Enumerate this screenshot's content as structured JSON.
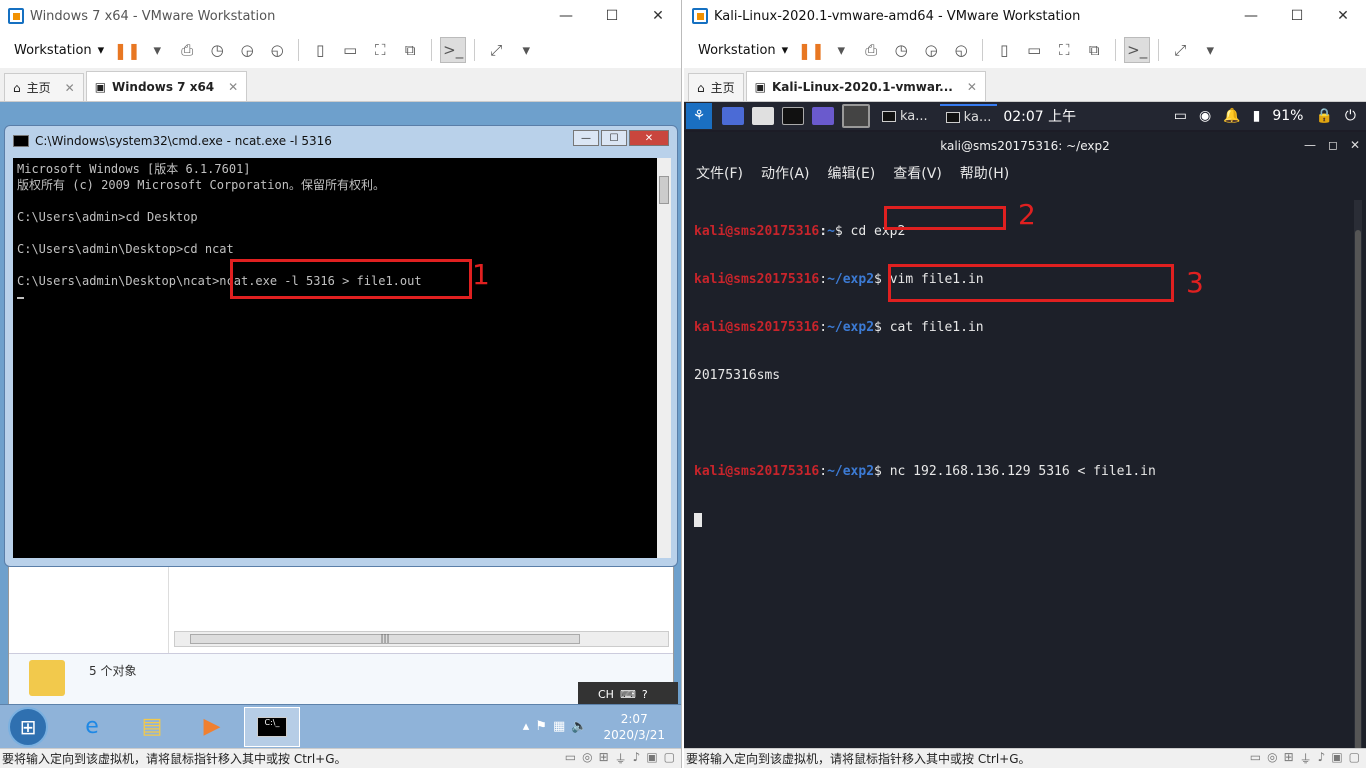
{
  "left_window": {
    "title": "Windows 7 x64 - VMware Workstation",
    "menu_label": "Workstation",
    "tabs": [
      {
        "label": "主页"
      },
      {
        "label": "Windows 7 x64"
      }
    ],
    "guest": {
      "cmd": {
        "title": "C:\\Windows\\system32\\cmd.exe - ncat.exe  -l 5316",
        "lines": [
          "Microsoft Windows [版本 6.1.7601]",
          "版权所有 (c) 2009 Microsoft Corporation。保留所有权利。",
          "",
          "C:\\Users\\admin>cd Desktop",
          "",
          "C:\\Users\\admin\\Desktop>cd ncat",
          "",
          "C:\\Users\\admin\\Desktop\\ncat>ncat.exe -l 5316 > file1.out"
        ]
      },
      "explorer": {
        "object_count": "5 个对象"
      },
      "ime_label": "CH",
      "clock": {
        "time": "2:07",
        "date": "2020/3/21"
      },
      "cmd_icon_label": "C:\\_"
    },
    "annotation": "1",
    "status": "要将输入定向到该虚拟机，请将鼠标指针移入其中或按 Ctrl+G。"
  },
  "right_window": {
    "title": "Kali-Linux-2020.1-vmware-amd64 - VMware Workstation",
    "menu_label": "Workstation",
    "tabs": [
      {
        "label": "主页"
      },
      {
        "label": "Kali-Linux-2020.1-vmwar..."
      }
    ],
    "guest": {
      "panel": {
        "win1": "ka...",
        "win2": "ka...",
        "clock": "02:07 上午",
        "battery": "91%"
      },
      "terminal": {
        "title": "kali@sms20175316: ~/exp2",
        "menus": [
          "文件(F)",
          "动作(A)",
          "编辑(E)",
          "查看(V)",
          "帮助(H)"
        ],
        "lines": [
          {
            "user": "kali@sms20175316",
            "path": "~",
            "cmd": "cd exp2"
          },
          {
            "user": "kali@sms20175316",
            "path": "~/exp2",
            "cmd": "vim file1.in"
          },
          {
            "user": "kali@sms20175316",
            "path": "~/exp2",
            "cmd": "cat file1.in"
          },
          {
            "output": "20175316sms"
          },
          {
            "output": ""
          },
          {
            "user": "kali@sms20175316",
            "path": "~/exp2",
            "cmd": "nc 192.168.136.129 5316 < file1.in"
          }
        ]
      }
    },
    "annotations": [
      "2",
      "3"
    ],
    "status": "要将输入定向到该虚拟机，请将鼠标指针移入其中或按 Ctrl+G。"
  }
}
